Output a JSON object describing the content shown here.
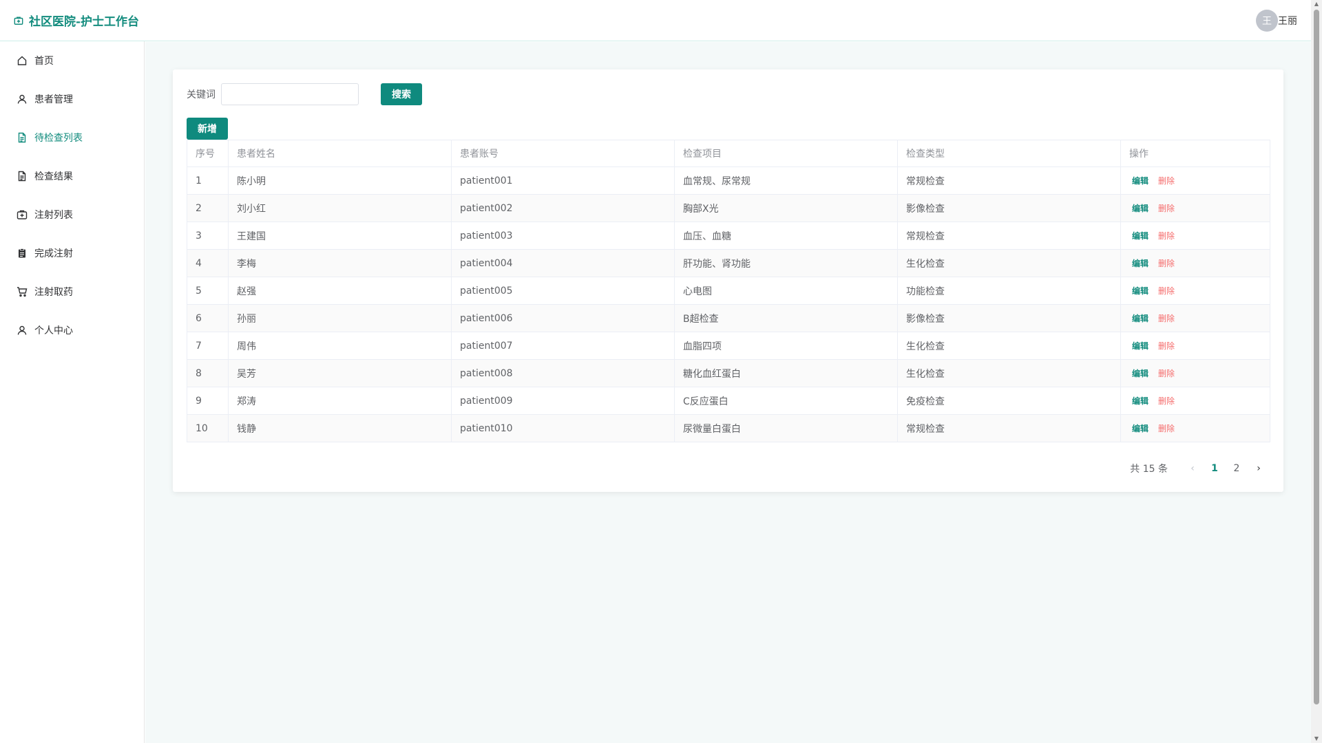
{
  "header": {
    "title": "社区医院-护士工作台",
    "user": {
      "avatar_text": "王",
      "name": "王丽"
    }
  },
  "sidebar": {
    "items": [
      {
        "label": "首页",
        "icon": "home-icon"
      },
      {
        "label": "患者管理",
        "icon": "user-icon"
      },
      {
        "label": "待检查列表",
        "icon": "document-icon",
        "active": true
      },
      {
        "label": "检查结果",
        "icon": "document-icon"
      },
      {
        "label": "注射列表",
        "icon": "first-aid-icon"
      },
      {
        "label": "完成注射",
        "icon": "clipboard-icon"
      },
      {
        "label": "注射取药",
        "icon": "cart-icon"
      },
      {
        "label": "个人中心",
        "icon": "user-icon"
      }
    ]
  },
  "search": {
    "label": "关键词",
    "value": "",
    "placeholder": "",
    "button": "搜索"
  },
  "add_button": "新增",
  "table": {
    "columns": [
      "序号",
      "患者姓名",
      "患者账号",
      "检查项目",
      "检查类型",
      "操作"
    ],
    "rows": [
      [
        "1",
        "陈小明",
        "patient001",
        "血常规、尿常规",
        "常规检查"
      ],
      [
        "2",
        "刘小红",
        "patient002",
        "胸部X光",
        "影像检查"
      ],
      [
        "3",
        "王建国",
        "patient003",
        "血压、血糖",
        "常规检查"
      ],
      [
        "4",
        "李梅",
        "patient004",
        "肝功能、肾功能",
        "生化检查"
      ],
      [
        "5",
        "赵强",
        "patient005",
        "心电图",
        "功能检查"
      ],
      [
        "6",
        "孙丽",
        "patient006",
        "B超检查",
        "影像检查"
      ],
      [
        "7",
        "周伟",
        "patient007",
        "血脂四项",
        "生化检查"
      ],
      [
        "8",
        "吴芳",
        "patient008",
        "糖化血红蛋白",
        "生化检查"
      ],
      [
        "9",
        "郑涛",
        "patient009",
        "C反应蛋白",
        "免疫检查"
      ],
      [
        "10",
        "钱静",
        "patient010",
        "尿微量白蛋白",
        "常规检查"
      ]
    ],
    "edit_label": "编辑",
    "delete_label": "删除"
  },
  "pagination": {
    "total_text": "共 15 条",
    "pages": [
      "1",
      "2"
    ],
    "current": "1"
  },
  "colors": {
    "accent": "#138c7e",
    "danger": "#f56c6c",
    "main_bg": "#f4f9f9"
  }
}
